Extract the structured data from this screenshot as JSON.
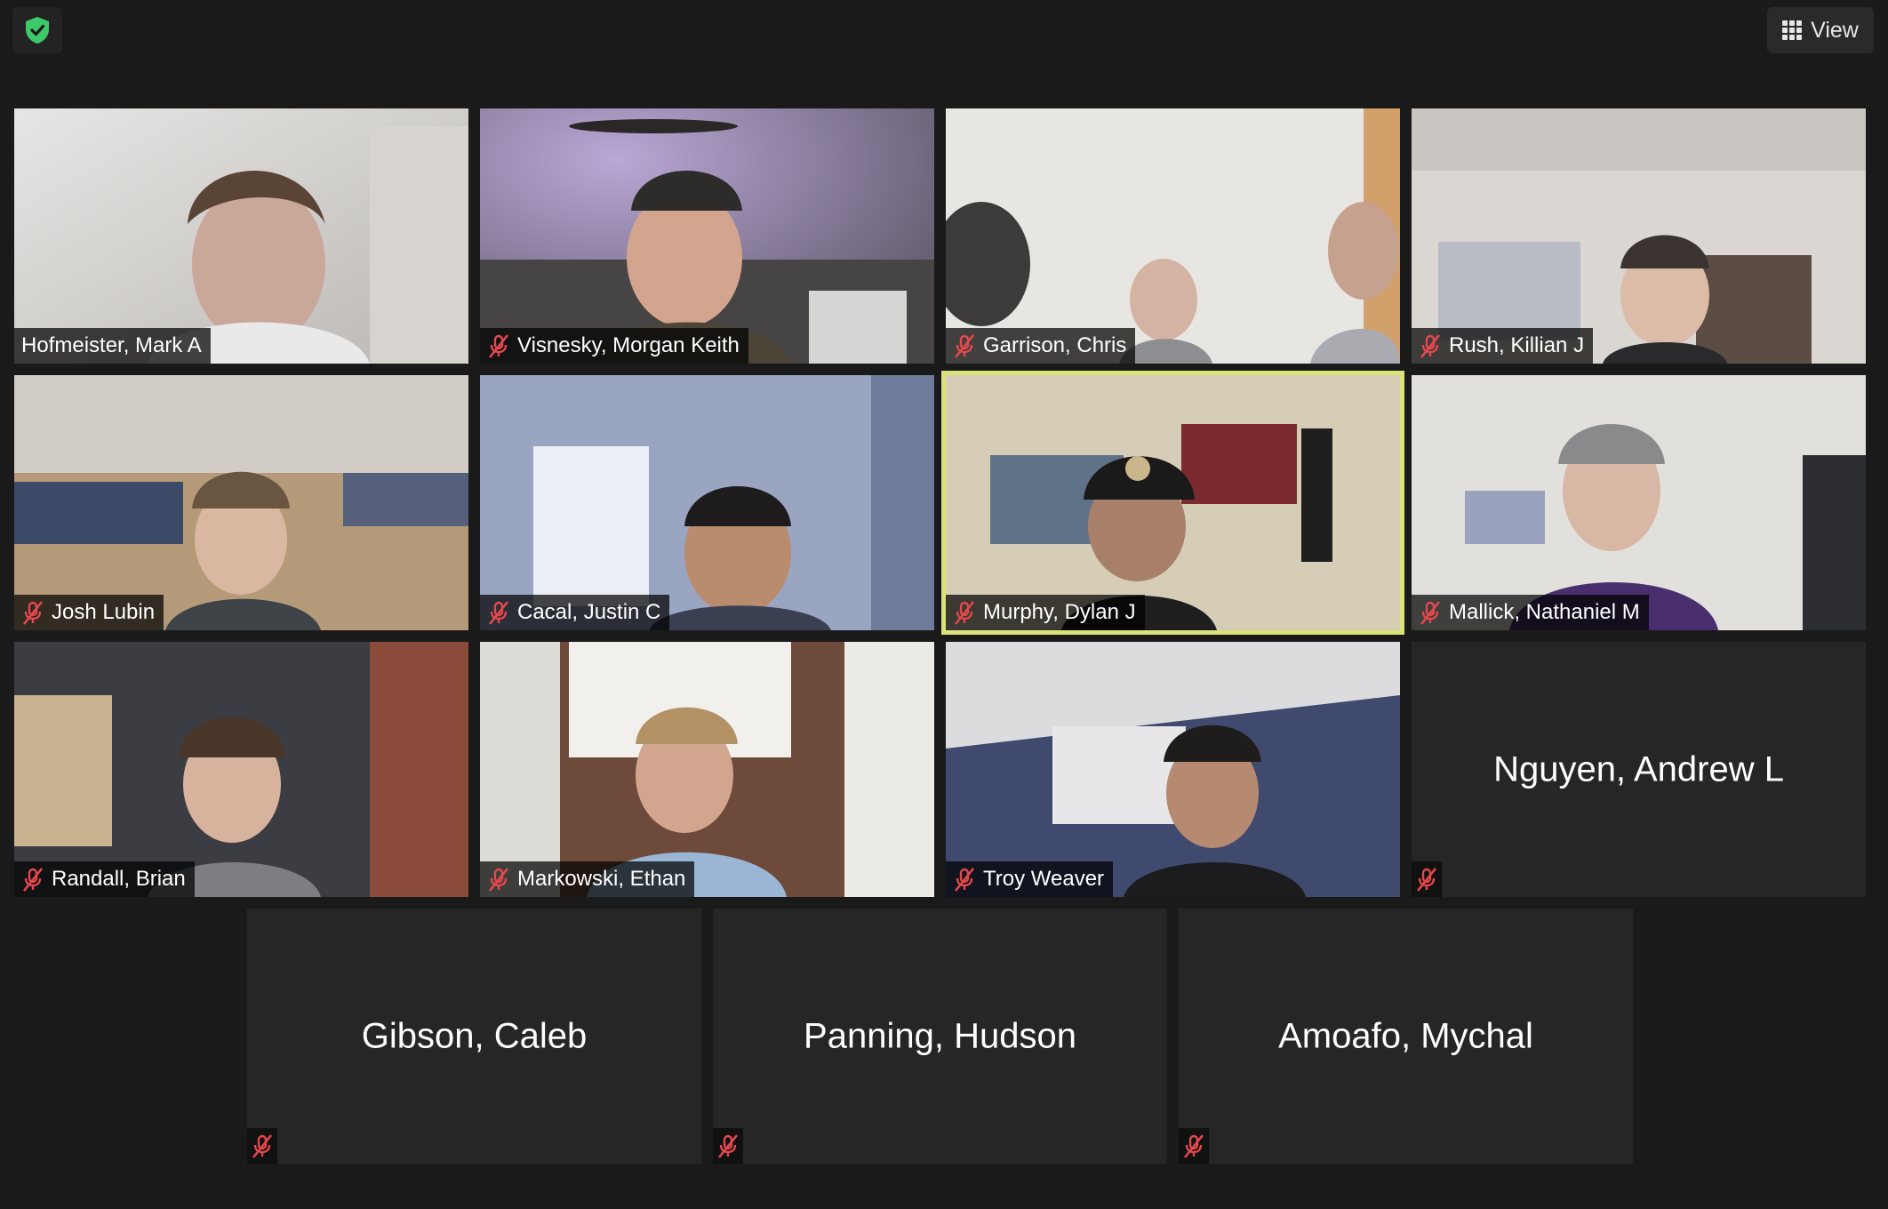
{
  "toolbar": {
    "security_icon": "shield-check-icon",
    "view_label": "View",
    "view_icon": "grid-icon"
  },
  "colors": {
    "background": "#1a1a1a",
    "tile": "#262626",
    "active_speaker_border": "#d9e37a",
    "muted_icon": "#e5484d",
    "shield": "#3cc96a"
  },
  "participants": [
    {
      "name": "Hofmeister, Mark A",
      "video": true,
      "muted": false,
      "active": false
    },
    {
      "name": "Visnesky, Morgan Keith",
      "video": true,
      "muted": true,
      "active": false
    },
    {
      "name": "Garrison, Chris",
      "video": true,
      "muted": true,
      "active": false
    },
    {
      "name": "Rush, Killian J",
      "video": true,
      "muted": true,
      "active": false
    },
    {
      "name": "Josh Lubin",
      "video": true,
      "muted": true,
      "active": false
    },
    {
      "name": "Cacal, Justin C",
      "video": true,
      "muted": true,
      "active": false
    },
    {
      "name": "Murphy, Dylan J",
      "video": true,
      "muted": true,
      "active": true
    },
    {
      "name": "Mallick, Nathaniel M",
      "video": true,
      "muted": true,
      "active": false
    },
    {
      "name": "Randall, Brian",
      "video": true,
      "muted": true,
      "active": false
    },
    {
      "name": "Markowski, Ethan",
      "video": true,
      "muted": true,
      "active": false
    },
    {
      "name": "Troy Weaver",
      "video": true,
      "muted": true,
      "active": false
    },
    {
      "name": "Nguyen, Andrew L",
      "video": false,
      "muted": true,
      "active": false
    },
    {
      "name": "Gibson, Caleb",
      "video": false,
      "muted": true,
      "active": false
    },
    {
      "name": "Panning, Hudson",
      "video": false,
      "muted": true,
      "active": false
    },
    {
      "name": "Amoafo, Mychal",
      "video": false,
      "muted": true,
      "active": false
    }
  ]
}
